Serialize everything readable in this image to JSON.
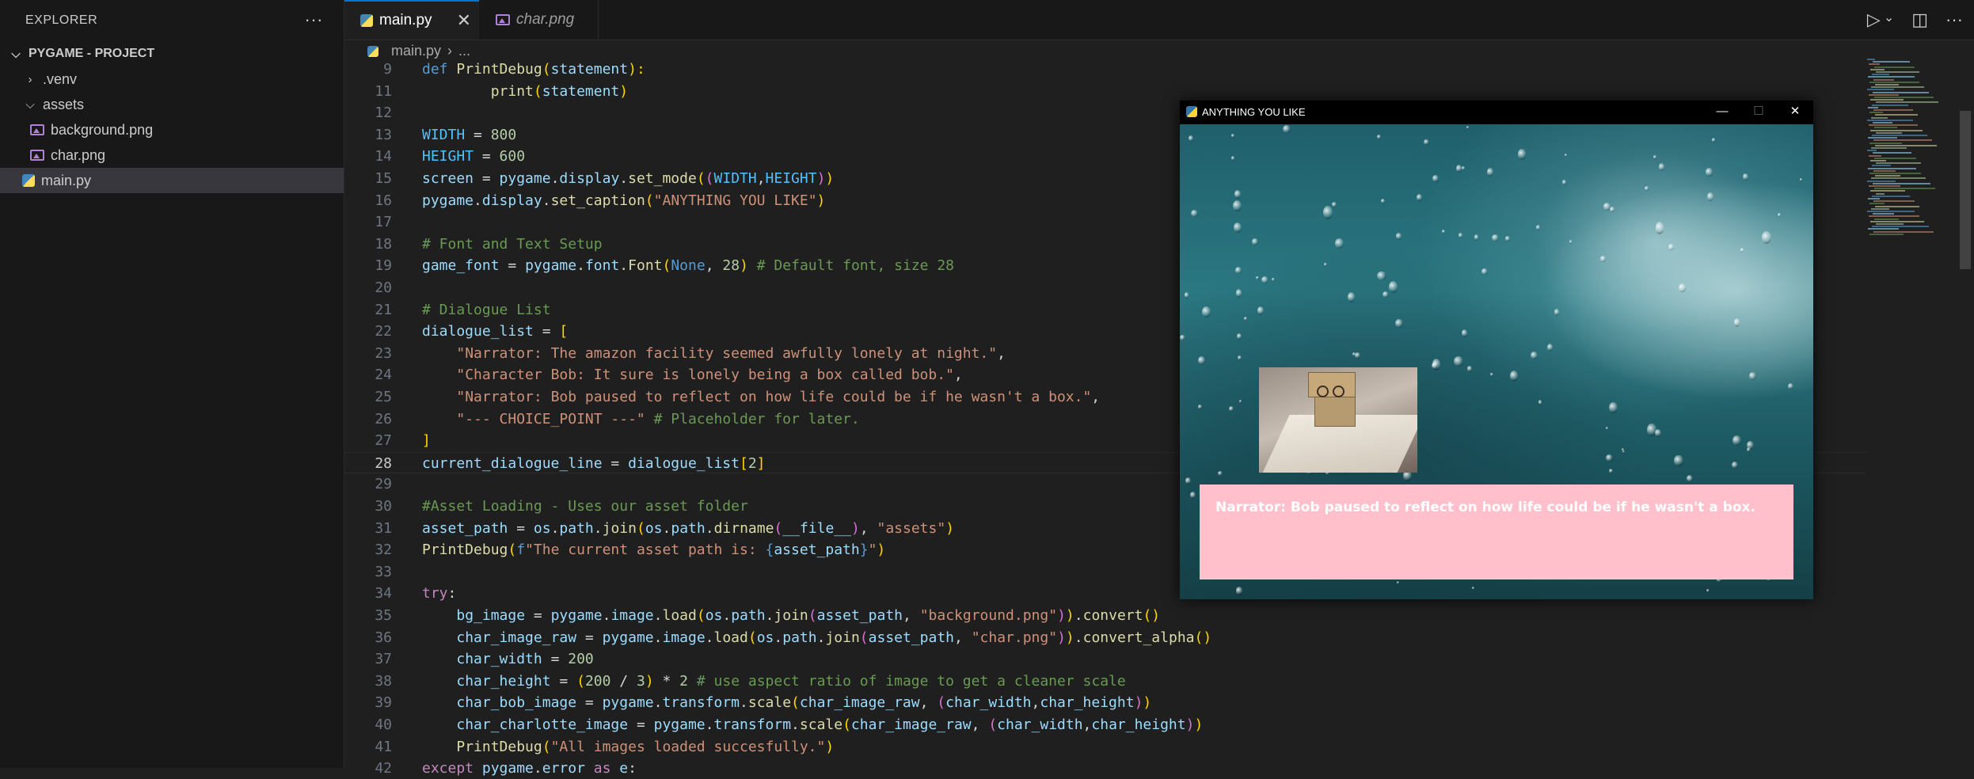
{
  "explorer": {
    "title": "EXPLORER",
    "more": "···",
    "project": "PYGAME - PROJECT",
    "items": [
      {
        "label": ".venv",
        "type": "folder-collapsed"
      },
      {
        "label": "assets",
        "type": "folder-expanded"
      },
      {
        "label": "background.png",
        "type": "image"
      },
      {
        "label": "char.png",
        "type": "image"
      },
      {
        "label": "main.py",
        "type": "python",
        "selected": true
      }
    ]
  },
  "tabs": [
    {
      "label": "main.py",
      "active": true,
      "close": "✕"
    },
    {
      "label": "char.png",
      "active": false
    }
  ],
  "toolbar": {
    "run": "▷",
    "run_menu": "⌄",
    "split": "◫",
    "more": "···"
  },
  "breadcrumb": {
    "file": "main.py",
    "sep": "›",
    "rest": "..."
  },
  "editor": {
    "lines": [
      {
        "n": "9",
        "segs": [
          [
            "k",
            "def "
          ],
          [
            "f",
            "PrintDebug"
          ],
          [
            "b1",
            "("
          ],
          [
            "v",
            "statement"
          ],
          [
            "b1",
            "):"
          ]
        ]
      },
      {
        "n": "11",
        "segs": [
          [
            "p",
            "        "
          ],
          [
            "f",
            "print"
          ],
          [
            "b1",
            "("
          ],
          [
            "v",
            "statement"
          ],
          [
            "b1",
            ")"
          ]
        ]
      },
      {
        "n": "12",
        "segs": []
      },
      {
        "n": "13",
        "segs": [
          [
            "cst",
            "WIDTH"
          ],
          [
            "p",
            " = "
          ],
          [
            "n",
            "800"
          ]
        ]
      },
      {
        "n": "14",
        "segs": [
          [
            "cst",
            "HEIGHT"
          ],
          [
            "p",
            " = "
          ],
          [
            "n",
            "600"
          ]
        ]
      },
      {
        "n": "15",
        "segs": [
          [
            "v",
            "screen"
          ],
          [
            "p",
            " = "
          ],
          [
            "v",
            "pygame"
          ],
          [
            "p",
            "."
          ],
          [
            "v",
            "display"
          ],
          [
            "p",
            "."
          ],
          [
            "f",
            "set_mode"
          ],
          [
            "b1",
            "("
          ],
          [
            "b2",
            "("
          ],
          [
            "cst",
            "WIDTH"
          ],
          [
            "p",
            ","
          ],
          [
            "cst",
            "HEIGHT"
          ],
          [
            "b2",
            ")"
          ],
          [
            "b1",
            ")"
          ]
        ]
      },
      {
        "n": "16",
        "segs": [
          [
            "v",
            "pygame"
          ],
          [
            "p",
            "."
          ],
          [
            "v",
            "display"
          ],
          [
            "p",
            "."
          ],
          [
            "f",
            "set_caption"
          ],
          [
            "b1",
            "("
          ],
          [
            "s",
            "\"ANYTHING YOU LIKE\""
          ],
          [
            "b1",
            ")"
          ]
        ]
      },
      {
        "n": "17",
        "segs": []
      },
      {
        "n": "18",
        "segs": [
          [
            "c",
            "# Font and Text Setup"
          ]
        ]
      },
      {
        "n": "19",
        "segs": [
          [
            "v",
            "game_font"
          ],
          [
            "p",
            " = "
          ],
          [
            "v",
            "pygame"
          ],
          [
            "p",
            "."
          ],
          [
            "v",
            "font"
          ],
          [
            "p",
            "."
          ],
          [
            "f",
            "Font"
          ],
          [
            "b1",
            "("
          ],
          [
            "k",
            "None"
          ],
          [
            "p",
            ", "
          ],
          [
            "n",
            "28"
          ],
          [
            "b1",
            ")"
          ],
          [
            "c",
            " # Default font, size 28"
          ]
        ]
      },
      {
        "n": "20",
        "segs": []
      },
      {
        "n": "21",
        "segs": [
          [
            "c",
            "# Dialogue List"
          ]
        ]
      },
      {
        "n": "22",
        "segs": [
          [
            "v",
            "dialogue_list"
          ],
          [
            "p",
            " = "
          ],
          [
            "b1",
            "["
          ]
        ]
      },
      {
        "n": "23",
        "segs": [
          [
            "p",
            "    "
          ],
          [
            "s",
            "\"Narrator: The amazon facility seemed awfully lonely at night.\""
          ],
          [
            "p",
            ","
          ]
        ]
      },
      {
        "n": "24",
        "segs": [
          [
            "p",
            "    "
          ],
          [
            "s",
            "\"Character Bob: It sure is lonely being a box called bob.\""
          ],
          [
            "p",
            ","
          ]
        ]
      },
      {
        "n": "25",
        "segs": [
          [
            "p",
            "    "
          ],
          [
            "s",
            "\"Narrator: Bob paused to reflect on how life could be if he wasn't a box.\""
          ],
          [
            "p",
            ","
          ]
        ]
      },
      {
        "n": "26",
        "segs": [
          [
            "p",
            "    "
          ],
          [
            "s",
            "\"--- CHOICE_POINT ---\""
          ],
          [
            "c",
            " # Placeholder for later."
          ]
        ]
      },
      {
        "n": "27",
        "segs": [
          [
            "b1",
            "]"
          ]
        ]
      },
      {
        "n": "28",
        "current": true,
        "segs": [
          [
            "v",
            "current_dialogue_line"
          ],
          [
            "p",
            " = "
          ],
          [
            "v",
            "dialogue_list"
          ],
          [
            "b1",
            "["
          ],
          [
            "n",
            "2"
          ],
          [
            "b1",
            "]"
          ]
        ]
      },
      {
        "n": "29",
        "segs": []
      },
      {
        "n": "30",
        "segs": [
          [
            "c",
            "#Asset Loading - Uses our asset folder"
          ]
        ]
      },
      {
        "n": "31",
        "segs": [
          [
            "v",
            "asset_path"
          ],
          [
            "p",
            " = "
          ],
          [
            "v",
            "os"
          ],
          [
            "p",
            "."
          ],
          [
            "v",
            "path"
          ],
          [
            "p",
            "."
          ],
          [
            "f",
            "join"
          ],
          [
            "b1",
            "("
          ],
          [
            "v",
            "os"
          ],
          [
            "p",
            "."
          ],
          [
            "v",
            "path"
          ],
          [
            "p",
            "."
          ],
          [
            "f",
            "dirname"
          ],
          [
            "b2",
            "("
          ],
          [
            "v",
            "__file__"
          ],
          [
            "b2",
            ")"
          ],
          [
            "p",
            ", "
          ],
          [
            "s",
            "\"assets\""
          ],
          [
            "b1",
            ")"
          ]
        ]
      },
      {
        "n": "32",
        "segs": [
          [
            "f",
            "PrintDebug"
          ],
          [
            "b1",
            "("
          ],
          [
            "k",
            "f"
          ],
          [
            "s",
            "\"The current asset path is: "
          ],
          [
            "k",
            "{"
          ],
          [
            "v",
            "asset_path"
          ],
          [
            "k",
            "}"
          ],
          [
            "s",
            "\""
          ],
          [
            "b1",
            ")"
          ]
        ]
      },
      {
        "n": "33",
        "segs": []
      },
      {
        "n": "34",
        "segs": [
          [
            "kf",
            "try"
          ],
          [
            "p",
            ":"
          ]
        ]
      },
      {
        "n": "35",
        "segs": [
          [
            "p",
            "    "
          ],
          [
            "v",
            "bg_image"
          ],
          [
            "p",
            " = "
          ],
          [
            "v",
            "pygame"
          ],
          [
            "p",
            "."
          ],
          [
            "v",
            "image"
          ],
          [
            "p",
            "."
          ],
          [
            "f",
            "load"
          ],
          [
            "b1",
            "("
          ],
          [
            "v",
            "os"
          ],
          [
            "p",
            "."
          ],
          [
            "v",
            "path"
          ],
          [
            "p",
            "."
          ],
          [
            "f",
            "join"
          ],
          [
            "b2",
            "("
          ],
          [
            "v",
            "asset_path"
          ],
          [
            "p",
            ", "
          ],
          [
            "s",
            "\"background.png\""
          ],
          [
            "b2",
            ")"
          ],
          [
            "b1",
            ")"
          ],
          [
            "p",
            "."
          ],
          [
            "f",
            "convert"
          ],
          [
            "b1",
            "()"
          ]
        ]
      },
      {
        "n": "36",
        "segs": [
          [
            "p",
            "    "
          ],
          [
            "v",
            "char_image_raw"
          ],
          [
            "p",
            " = "
          ],
          [
            "v",
            "pygame"
          ],
          [
            "p",
            "."
          ],
          [
            "v",
            "image"
          ],
          [
            "p",
            "."
          ],
          [
            "f",
            "load"
          ],
          [
            "b1",
            "("
          ],
          [
            "v",
            "os"
          ],
          [
            "p",
            "."
          ],
          [
            "v",
            "path"
          ],
          [
            "p",
            "."
          ],
          [
            "f",
            "join"
          ],
          [
            "b2",
            "("
          ],
          [
            "v",
            "asset_path"
          ],
          [
            "p",
            ", "
          ],
          [
            "s",
            "\"char.png\""
          ],
          [
            "b2",
            ")"
          ],
          [
            "b1",
            ")"
          ],
          [
            "p",
            "."
          ],
          [
            "f",
            "convert_alpha"
          ],
          [
            "b1",
            "()"
          ]
        ]
      },
      {
        "n": "37",
        "segs": [
          [
            "p",
            "    "
          ],
          [
            "v",
            "char_width"
          ],
          [
            "p",
            " = "
          ],
          [
            "n",
            "200"
          ]
        ]
      },
      {
        "n": "38",
        "segs": [
          [
            "p",
            "    "
          ],
          [
            "v",
            "char_height"
          ],
          [
            "p",
            " = "
          ],
          [
            "b1",
            "("
          ],
          [
            "n",
            "200"
          ],
          [
            "p",
            " / "
          ],
          [
            "n",
            "3"
          ],
          [
            "b1",
            ")"
          ],
          [
            "p",
            " * "
          ],
          [
            "n",
            "2"
          ],
          [
            "c",
            " # use aspect ratio of image to get a cleaner scale"
          ]
        ]
      },
      {
        "n": "39",
        "segs": [
          [
            "p",
            "    "
          ],
          [
            "v",
            "char_bob_image"
          ],
          [
            "p",
            " = "
          ],
          [
            "v",
            "pygame"
          ],
          [
            "p",
            "."
          ],
          [
            "v",
            "transform"
          ],
          [
            "p",
            "."
          ],
          [
            "f",
            "scale"
          ],
          [
            "b1",
            "("
          ],
          [
            "v",
            "char_image_raw"
          ],
          [
            "p",
            ", "
          ],
          [
            "b2",
            "("
          ],
          [
            "v",
            "char_width"
          ],
          [
            "p",
            ","
          ],
          [
            "v",
            "char_height"
          ],
          [
            "b2",
            ")"
          ],
          [
            "b1",
            ")"
          ]
        ]
      },
      {
        "n": "40",
        "segs": [
          [
            "p",
            "    "
          ],
          [
            "v",
            "char_charlotte_image"
          ],
          [
            "p",
            " = "
          ],
          [
            "v",
            "pygame"
          ],
          [
            "p",
            "."
          ],
          [
            "v",
            "transform"
          ],
          [
            "p",
            "."
          ],
          [
            "f",
            "scale"
          ],
          [
            "b1",
            "("
          ],
          [
            "v",
            "char_image_raw"
          ],
          [
            "p",
            ", "
          ],
          [
            "b2",
            "("
          ],
          [
            "v",
            "char_width"
          ],
          [
            "p",
            ","
          ],
          [
            "v",
            "char_height"
          ],
          [
            "b2",
            ")"
          ],
          [
            "b1",
            ")"
          ]
        ]
      },
      {
        "n": "41",
        "segs": [
          [
            "p",
            "    "
          ],
          [
            "f",
            "PrintDebug"
          ],
          [
            "b1",
            "("
          ],
          [
            "s",
            "\"All images loaded succesfully.\""
          ],
          [
            "b1",
            ")"
          ]
        ]
      },
      {
        "n": "42",
        "segs": [
          [
            "kf",
            "except "
          ],
          [
            "v",
            "pygame"
          ],
          [
            "p",
            "."
          ],
          [
            "v",
            "error"
          ],
          [
            "kf",
            " as "
          ],
          [
            "v",
            "e"
          ],
          [
            "p",
            ":"
          ]
        ]
      }
    ]
  },
  "game_window": {
    "title": "ANYTHING YOU LIKE",
    "controls": {
      "minimize": "—",
      "maximize": "☐",
      "close": "✕"
    },
    "dialogue": "Narrator: Bob paused to reflect on how life could be if he wasn't a box.",
    "dialog_color": "#ffc0cb"
  },
  "colors": {
    "accent": "#0078d4",
    "editor_bg": "#1f1f1f",
    "sidebar_bg": "#181818"
  }
}
